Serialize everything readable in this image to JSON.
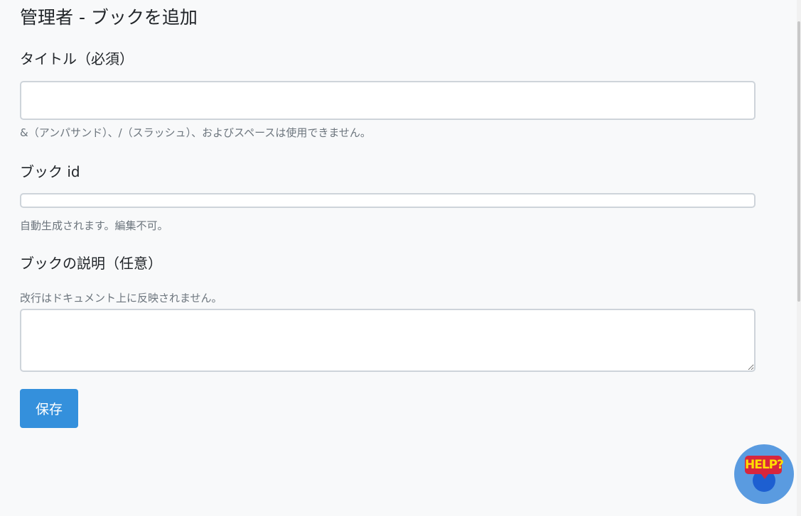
{
  "page": {
    "title": "管理者 - ブックを追加"
  },
  "form": {
    "title_field": {
      "label": "タイトル（必須）",
      "value": "",
      "help": "&（アンパサンド）、/（スラッシュ）、およびスペースは使用できません。"
    },
    "book_id_field": {
      "label": "ブック id",
      "value": "",
      "help": "自動生成されます。編集不可。"
    },
    "description_field": {
      "label": "ブックの説明（任意）",
      "help": "改行はドキュメント上に反映されません。",
      "value": ""
    },
    "save_label": "保存"
  },
  "help_widget": {
    "label": "HELP?",
    "icon": "help-chat-icon"
  },
  "colors": {
    "primary": "#3490dc",
    "help_widget": "#5a9be0",
    "help_badge": "#d7263d",
    "help_badge_text": "#ffdd00"
  }
}
